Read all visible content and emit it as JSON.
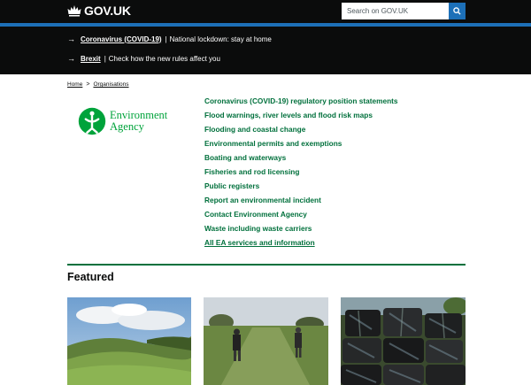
{
  "header": {
    "logo_text": "GOV.UK",
    "search_placeholder": "Search on GOV.UK"
  },
  "notices": [
    {
      "link": "Coronavirus (COVID-19)",
      "text": "National lockdown: stay at home"
    },
    {
      "link": "Brexit",
      "text": "Check how the new rules affect you"
    }
  ],
  "breadcrumb": {
    "home": "Home",
    "organisations": "Organisations"
  },
  "organisation": {
    "name_line1": "Environment",
    "name_line2": "Agency"
  },
  "links": [
    "Coronavirus (COVID-19) regulatory position statements",
    "Flood warnings, river levels and flood risk maps",
    "Flooding and coastal change",
    "Environmental permits and exemptions",
    "Boating and waterways",
    "Fisheries and rod licensing",
    "Public registers",
    "Report an environmental incident",
    "Contact Environment Agency",
    "Waste including waste carriers",
    "All EA services and information"
  ],
  "featured_heading": "Featured",
  "colors": {
    "header_bg": "#0b0c0c",
    "brand_blue": "#1d70b8",
    "link_green": "#00703c",
    "ea_green": "#00a33b"
  }
}
